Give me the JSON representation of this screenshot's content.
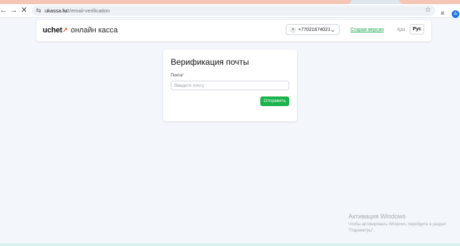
{
  "browser": {
    "url_host": "ukassa.kz",
    "url_path": "/v2/email-verification",
    "back_icon": "back-arrow-icon",
    "forward_icon": "forward-arrow-icon",
    "close_icon": "close-icon",
    "profile_initial": "A"
  },
  "header": {
    "logo_brand": "uchet",
    "logo_subtitle": "онлайн касса",
    "account_phone": "+77021674021",
    "old_version_label": "Старая версия",
    "lang_kaz": "Қаз",
    "lang_rus": "Рус",
    "accent_color": "#1cb34e",
    "logo_accent_color": "#e8532b"
  },
  "verification": {
    "title": "Верификация почты",
    "email_label": "Почта",
    "required_mark": "*",
    "email_placeholder": "Введите почту",
    "email_value": "",
    "submit_label": "Отправить"
  },
  "watermark": {
    "title": "Активация Windows",
    "text": "Чтобы активировать Windows, перейдите в раздел \"Параметры\"."
  }
}
